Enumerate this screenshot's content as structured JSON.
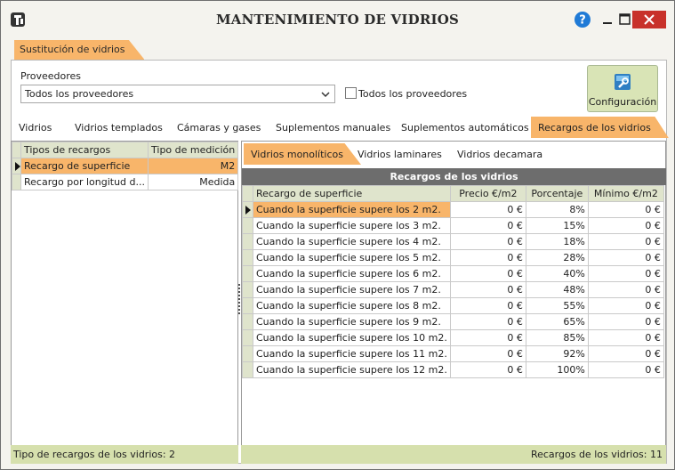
{
  "window": {
    "title": "MANTENIMIENTO DE VIDRIOS"
  },
  "outer_tab": "Sustitución de vidrios",
  "providers": {
    "label": "Proveedores",
    "selected": "Todos los proveedores",
    "checkbox_label": "Todos los proveedores"
  },
  "config_button": "Configuración",
  "tabs": [
    "Vidrios",
    "Vidrios templados",
    "Cámaras y gases",
    "Suplementos manuales",
    "Suplementos automáticos",
    "Recargos de los vidrios"
  ],
  "left_grid": {
    "headers": [
      "Tipos de recargos",
      "Tipo de medición"
    ],
    "rows": [
      [
        "Recargo de superficie",
        "M2"
      ],
      [
        "Recargo por longitud d...",
        "Medida"
      ]
    ]
  },
  "subtabs": [
    "Vidrios monolíticos",
    "Vidrios laminares",
    "Vidrios decamara"
  ],
  "right_grid": {
    "title": "Recargos de los vidrios",
    "headers": [
      "Recargo de superficie",
      "Precio €/m2",
      "Porcentaje",
      "Mínimo €/m2"
    ],
    "rows": [
      [
        "Cuando la superficie supere los 2 m2.",
        "0 €",
        "8%",
        "0 €"
      ],
      [
        "Cuando la superficie supere los 3 m2.",
        "0 €",
        "15%",
        "0 €"
      ],
      [
        "Cuando la superficie supere los 4 m2.",
        "0 €",
        "18%",
        "0 €"
      ],
      [
        "Cuando la superficie supere los 5 m2.",
        "0 €",
        "28%",
        "0 €"
      ],
      [
        "Cuando la superficie supere los 6 m2.",
        "0 €",
        "40%",
        "0 €"
      ],
      [
        "Cuando la superficie supere los 7 m2.",
        "0 €",
        "48%",
        "0 €"
      ],
      [
        "Cuando la superficie supere los 8 m2.",
        "0 €",
        "55%",
        "0 €"
      ],
      [
        "Cuando la superficie supere los 9 m2.",
        "0 €",
        "65%",
        "0 €"
      ],
      [
        "Cuando la superficie supere los 10 m2.",
        "0 €",
        "85%",
        "0 €"
      ],
      [
        "Cuando la superficie supere los 11 m2.",
        "0 €",
        "92%",
        "0 €"
      ],
      [
        "Cuando la superficie supere los 12 m2.",
        "0 €",
        "100%",
        "0 €"
      ]
    ]
  },
  "status": {
    "left": "Tipo de recargos de los vidrios: 2",
    "right": "Recargos de los vidrios: 11"
  },
  "icons": {
    "app": "app-logo-icon",
    "help": "help-icon",
    "minimize": "minimize-icon",
    "maximize": "maximize-icon",
    "close": "close-icon",
    "config": "configuration-icon"
  },
  "colors": {
    "accent_orange": "#f8b56a",
    "header_green": "#dfe4cc",
    "status_green": "#d6e0ad",
    "close_red": "#c8312a",
    "help_blue": "#1f7ad6"
  }
}
